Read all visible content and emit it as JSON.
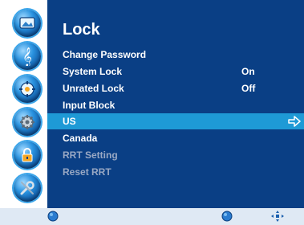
{
  "menu": {
    "title": "Lock",
    "items": [
      {
        "label": "Change Password",
        "value": ""
      },
      {
        "label": "System Lock",
        "value": "On"
      },
      {
        "label": "Unrated Lock",
        "value": "Off"
      },
      {
        "label": "Input Block",
        "value": ""
      },
      {
        "label": "US",
        "value": ""
      },
      {
        "label": "Canada",
        "value": ""
      },
      {
        "label": "RRT Setting",
        "value": ""
      },
      {
        "label": "Reset RRT",
        "value": ""
      }
    ],
    "selected_index": 4
  },
  "left_rail": {
    "icons": [
      "picture-icon",
      "audio-icon",
      "setup-icon",
      "channel-icon",
      "lock-icon",
      "tools-icon"
    ]
  },
  "bottom_bar": {
    "icons": [
      "menu-button-icon",
      "enter-button-icon",
      "navigate-arrows-icon"
    ]
  },
  "colors": {
    "panel": "#0a3f85",
    "selection": "#1e9ad6",
    "bottom_bar": "#dfe9f4",
    "dim_text": "#9aa9c4"
  }
}
